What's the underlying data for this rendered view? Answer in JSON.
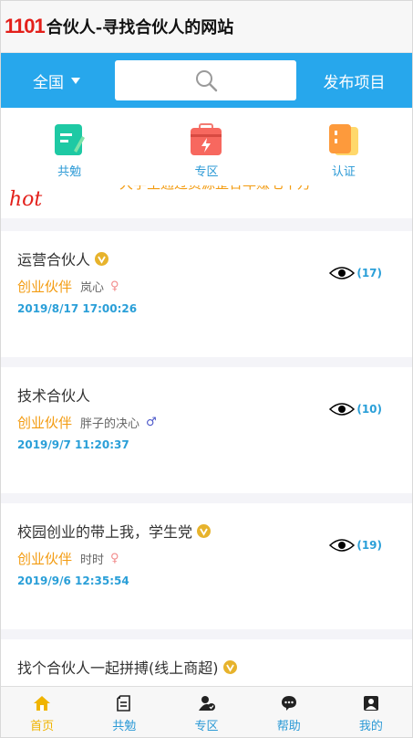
{
  "header": {
    "logo_num": "1101",
    "logo_text": "合伙人-寻找合伙人的网站"
  },
  "searchbar": {
    "city": "全国",
    "publish_label": "发布项目"
  },
  "quick_links": [
    {
      "label": "共勉",
      "icon": "note-icon"
    },
    {
      "label": "专区",
      "icon": "toolbox-icon"
    },
    {
      "label": "认证",
      "icon": "certificate-icon"
    }
  ],
  "ticker": {
    "text": "大学生通过资源整合年赚七十万",
    "hot_label": "hot"
  },
  "posts": [
    {
      "title": "运营合伙人",
      "type": "创业伙伴",
      "user": "岚心",
      "sex": "♀",
      "date": "2019/8/17 17:00:26",
      "views": "(17)"
    },
    {
      "title": "技术合伙人",
      "type": "创业伙伴",
      "user": "胖子的决心",
      "sex": "♂",
      "date": "2019/9/7 11:20:37",
      "views": "(10)"
    },
    {
      "title": "校园创业的带上我，学生党",
      "type": "创业伙伴",
      "user": "时时",
      "sex": "♀",
      "date": "2019/9/6 12:35:54",
      "views": "(19)"
    },
    {
      "title": "找个合伙人一起拼搏(线上商超)"
    }
  ],
  "bottom_nav": [
    {
      "label": "首页",
      "icon": "home-icon"
    },
    {
      "label": "共勉",
      "icon": "document-icon"
    },
    {
      "label": "专区",
      "icon": "verified-user-icon"
    },
    {
      "label": "帮助",
      "icon": "chat-icon"
    },
    {
      "label": "我的",
      "icon": "person-icon"
    }
  ],
  "colors": {
    "primary": "#27a7ec",
    "accent": "#f39c12",
    "logo_red": "#e3201b",
    "nav_active": "#f0b400"
  }
}
